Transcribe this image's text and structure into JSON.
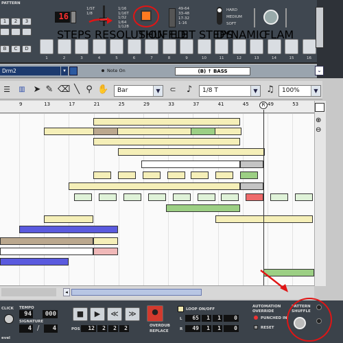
{
  "device": {
    "pattern_label": "PATTERN",
    "pattern_buttons": [
      "1",
      "2",
      "3",
      "4",
      "B",
      "C",
      "D"
    ],
    "steps_value": "16",
    "steps_label": "STEPS",
    "resolution_label": "RESOLUTION",
    "resolution_options_left": [
      "1/ST",
      "1/8",
      "1/16",
      "1/32"
    ],
    "resolution_options_right": [
      "1/16",
      "1/16T",
      "1/32",
      "1/64",
      "1/128"
    ],
    "shuffle_label": "SHUFFLE",
    "edit_steps_label": "EDIT STEPS",
    "edit_steps_options": [
      "49-64",
      "33-48",
      "17-32",
      "1-16"
    ],
    "dynamic_label": "DYNAMIC",
    "dynamic_options": [
      "HARD",
      "MEDIUM",
      "SOFT"
    ],
    "flam_label": "FLAM",
    "step_numbers": [
      "1",
      "2",
      "3",
      "4",
      "5",
      "6",
      "7",
      "8",
      "9",
      "10",
      "11",
      "12",
      "13",
      "14",
      "15",
      "16"
    ]
  },
  "sequencer_bar": {
    "track_name": "Drm2",
    "note_on_label": "Note On",
    "pass_label": "(B) ↑ BASS"
  },
  "toolbar": {
    "snap_value": "Bar",
    "quantize_value": "1/8 T",
    "zoom_value": "100%"
  },
  "ruler": {
    "bars": [
      "9",
      "13",
      "17",
      "21",
      "25",
      "29",
      "33",
      "37",
      "41",
      "45",
      "49",
      "53"
    ],
    "playhead_marker": "R"
  },
  "transport": {
    "click_label": "CLICK",
    "level_label": "evel",
    "tempo_label": "TEMPO",
    "tempo_value": "94",
    "tempo_fraction": "000",
    "signature_label": "SIGNATURE",
    "sig_num": "4",
    "sig_den": "4",
    "pos_label": "POS",
    "pos_values": [
      "12",
      "2",
      "2",
      "2"
    ],
    "overdub_label": "OVERDUB",
    "replace_label": "REPLACE",
    "loop_label": "LOOP ON/OFF",
    "loop_L": "L",
    "loop_R": "R",
    "loop_L_values": [
      "65",
      "1",
      "1",
      "0"
    ],
    "loop_R_values": [
      "49",
      "1",
      "1",
      "0"
    ],
    "automation_label": "AUTOMATION",
    "override_label": "OVERRIDE",
    "punched_in_label": "PUNCHED IN",
    "reset_label": "RESET",
    "pattern_shuffle_label": "PATTERN SHUFFLE"
  },
  "colors": {
    "annotation_red": "#e01515",
    "device_bg": "#3f4750",
    "grid_bg": "#fafafa"
  }
}
